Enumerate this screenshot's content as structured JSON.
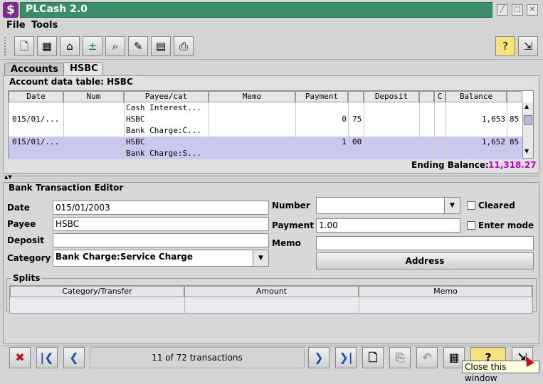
{
  "window": {
    "title": "PLCash 2.0"
  },
  "menu": {
    "file": "File",
    "tools": "Tools"
  },
  "tabs": {
    "accounts": "Accounts",
    "hsbc": "HSBC"
  },
  "account_table": {
    "heading": "Account data table: HSBC",
    "columns": [
      "Date",
      "Num",
      "Payee/cat",
      "Memo",
      "Payment",
      "",
      "Deposit",
      "",
      "C",
      "Balance",
      ""
    ],
    "rows": [
      {
        "date": "",
        "num": "",
        "payee": "Cash Interest...",
        "payment": "",
        "payment_cents": "",
        "balance": "",
        "balance_cents": ""
      },
      {
        "date": "015/01/...",
        "num": "",
        "payee": "HSBC",
        "payment": "0",
        "payment_cents": "75",
        "balance": "1,653",
        "balance_cents": "85"
      },
      {
        "date": "",
        "num": "",
        "payee": "Bank Charge:C...",
        "payment": "",
        "payment_cents": "",
        "balance": "",
        "balance_cents": ""
      },
      {
        "date": "015/01/...",
        "num": "",
        "payee": "HSBC",
        "payment": "1",
        "payment_cents": "00",
        "balance": "1,652",
        "balance_cents": "85"
      },
      {
        "date": "",
        "num": "",
        "payee": "Bank Charge:S...",
        "payment": "",
        "payment_cents": "",
        "balance": "",
        "balance_cents": ""
      }
    ],
    "ending_balance_label": "Ending Balance:",
    "ending_balance_value": "11,318.27"
  },
  "editor": {
    "heading": "Bank Transaction Editor",
    "date_label": "Date",
    "date_value": "015/01/2003",
    "payee_label": "Payee",
    "payee_value": "HSBC",
    "deposit_label": "Deposit",
    "deposit_value": "",
    "category_label": "Category",
    "category_value": "Bank Charge:Service Charge",
    "number_label": "Number",
    "number_value": "",
    "payment_label": "Payment",
    "payment_value": "1.00",
    "memo_label": "Memo",
    "memo_value": "",
    "cleared_label": "Cleared",
    "enter_mode_label": "Enter mode",
    "address_button": "Address"
  },
  "splits": {
    "heading": "Splits",
    "columns": [
      "Category/Transfer",
      "Amount",
      "Memo"
    ]
  },
  "nav": {
    "status": "11 of 72 transactions",
    "tooltip": "Close this window"
  },
  "colors": {
    "title_bar": "#3b8f68",
    "selected_row": "#c9c9f0",
    "ending_balance": "#c000c0"
  }
}
